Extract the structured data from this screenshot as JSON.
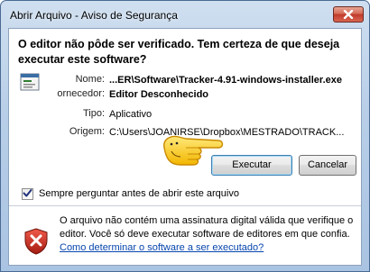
{
  "window": {
    "title": "Abrir Arquivo - Aviso de Segurança"
  },
  "dialog": {
    "heading": "O editor não pôde ser verificado. Tem certeza de que deseja executar este software?",
    "fields": [
      {
        "label": "Nome:",
        "value": "...ER\\Software\\Tracker-4.91-windows-installer.exe",
        "bold": true
      },
      {
        "label": "ornecedor:",
        "value": "Editor Desconhecido",
        "bold": true
      },
      {
        "label": "Tipo:",
        "value": "Aplicativo",
        "bold": false
      },
      {
        "label": "Origem:",
        "value": "C:\\Users\\JOANIRSE\\Dropbox\\MESTRADO\\TRACK...",
        "bold": false
      }
    ],
    "buttons": {
      "run_label": "Executar",
      "cancel_label": "Cancelar"
    },
    "checkbox": {
      "label": "Sempre perguntar antes de abrir este arquivo",
      "checked": true
    },
    "warning": {
      "text": "O arquivo não contém uma assinatura digital válida que verifique o editor. Você só deve executar software de editores em que confia.",
      "link_text": "Como determinar o software a ser executado?"
    }
  },
  "colors": {
    "title_bar": "#b9cfe8",
    "close_button": "#c0392b",
    "link": "#0645ad",
    "default_button_border": "#3c7fb1",
    "shield_red": "#c62828"
  },
  "icons": [
    "close-icon",
    "application-file-icon",
    "pointing-hand-icon",
    "checkmark-icon",
    "warning-shield-icon"
  ]
}
